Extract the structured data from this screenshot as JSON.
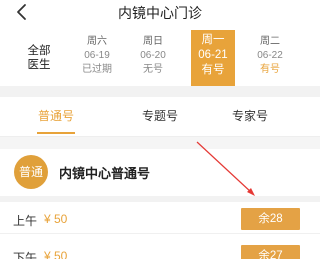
{
  "header": {
    "title": "内镜中心门诊"
  },
  "filter": {
    "all_doctors_label": "全部医生"
  },
  "days": [
    {
      "weekday": "周六",
      "date": "06-19",
      "status": "已过期"
    },
    {
      "weekday": "周日",
      "date": "06-20",
      "status": "无号"
    },
    {
      "weekday": "周一",
      "date": "06-21",
      "status": "有号"
    },
    {
      "weekday": "周二",
      "date": "06-22",
      "status": "有号"
    }
  ],
  "selected_day_index": 2,
  "tabs": [
    {
      "label": "普通号"
    },
    {
      "label": "专题号"
    },
    {
      "label": "专家号"
    }
  ],
  "active_tab_index": 0,
  "section": {
    "badge": "普通",
    "name": "内镜中心普通号"
  },
  "slots": [
    {
      "period": "上午",
      "price": "¥ 50",
      "remaining": "余28"
    },
    {
      "period": "下午",
      "price": "¥ 50",
      "remaining": "余27"
    }
  ],
  "colors": {
    "accent": "#e8a33a",
    "annotation_arrow": "#e53935"
  },
  "icons": {
    "back": "chevron-left-icon"
  }
}
